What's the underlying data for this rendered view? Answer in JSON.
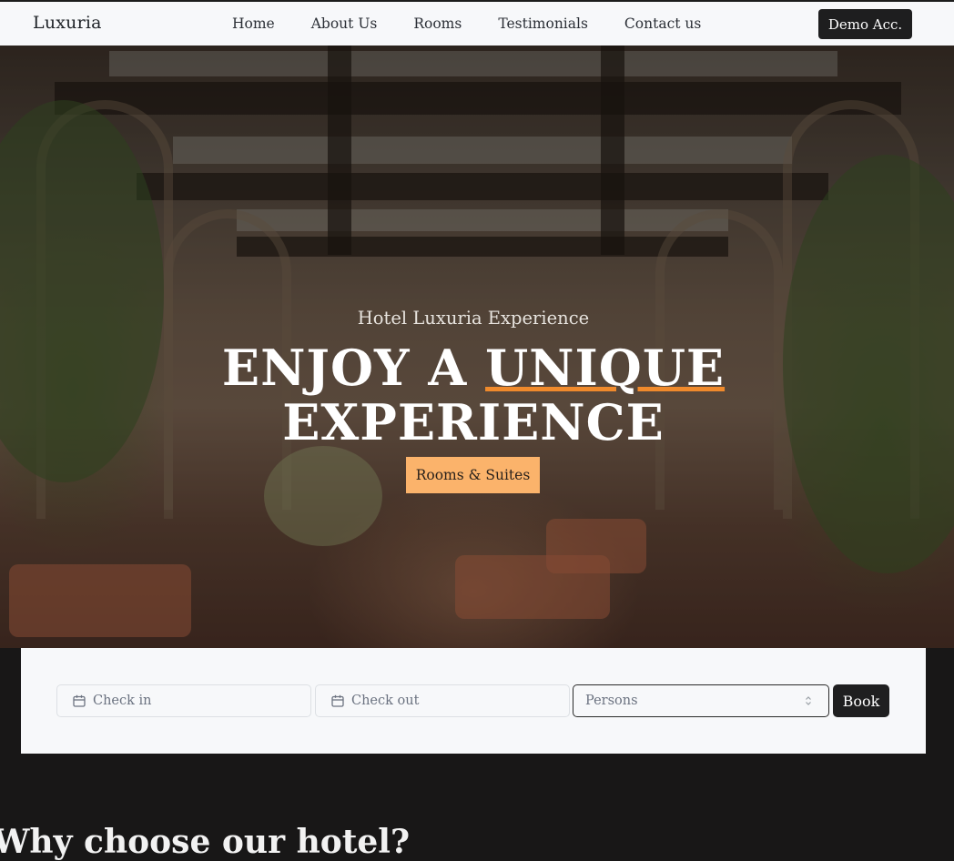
{
  "navbar": {
    "brand": "Luxuria",
    "links": [
      "Home",
      "About Us",
      "Rooms",
      "Testimonials",
      "Contact us"
    ],
    "demo_button": "Demo Acc."
  },
  "hero": {
    "subtitle": "Hotel Luxuria Experience",
    "title_part1": "ENJOY A ",
    "title_highlight": "UNIQUE",
    "title_line2": "EXPERIENCE",
    "cta_label": "Rooms & Suites"
  },
  "booking": {
    "check_in_placeholder": "Check in",
    "check_out_placeholder": "Check out",
    "persons_placeholder": "Persons",
    "book_label": "Book"
  },
  "section": {
    "title": "Why choose our hotel?"
  },
  "colors": {
    "accent": "#fbb36b",
    "underline": "#f08a2c",
    "dark": "#181717"
  }
}
